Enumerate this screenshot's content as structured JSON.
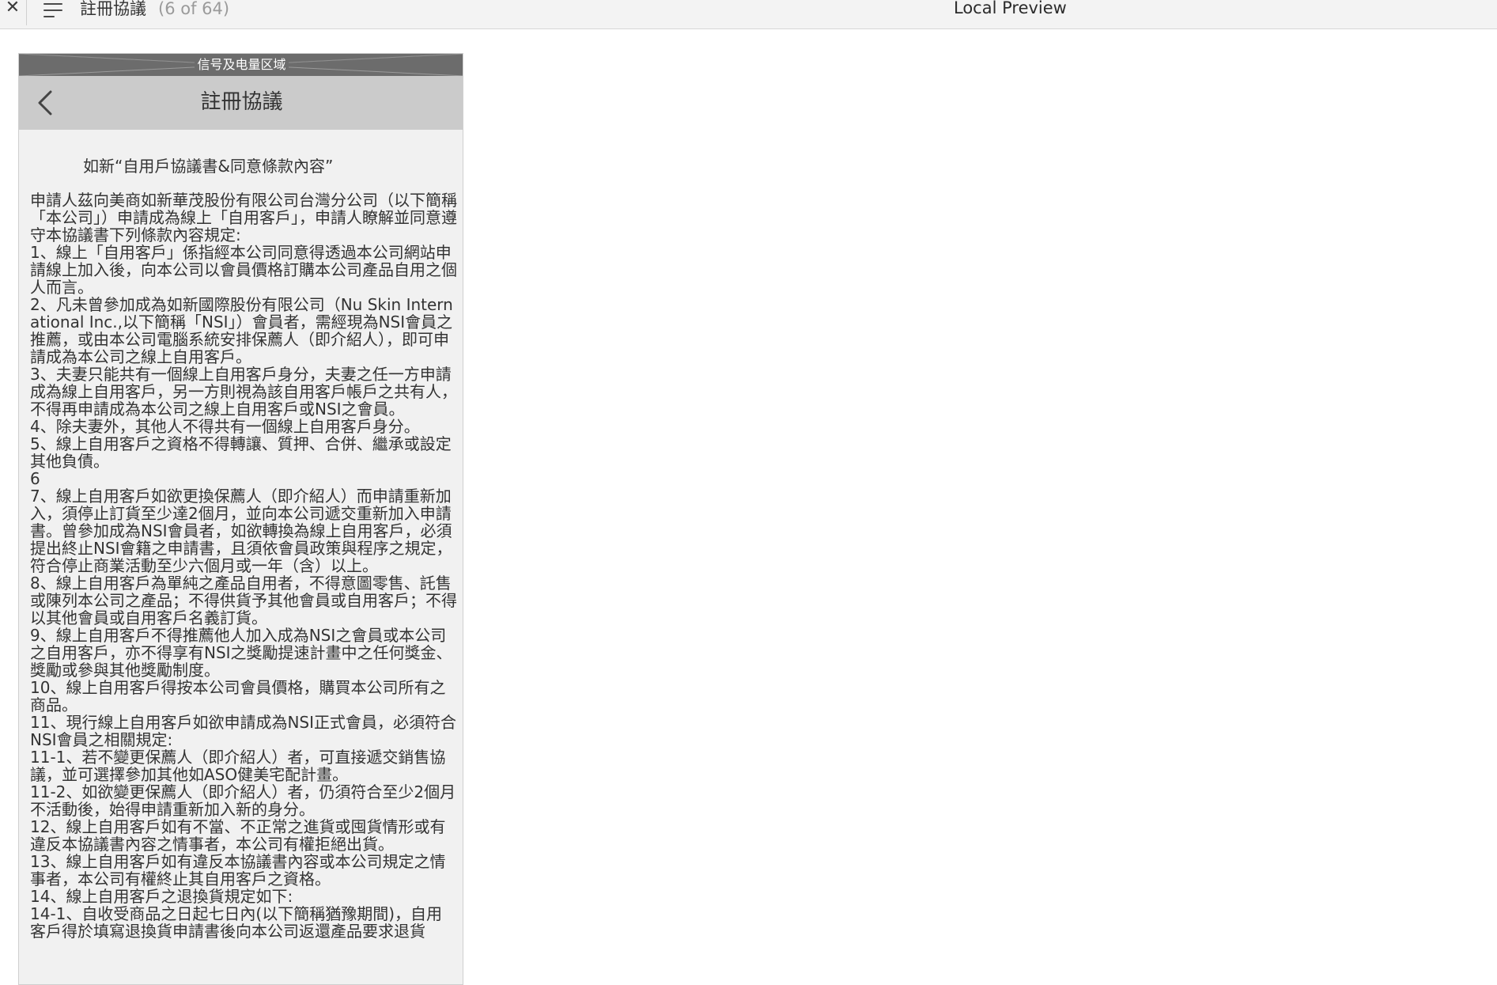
{
  "toolbar": {
    "close_glyph": "✕",
    "document_title": "註冊協議",
    "page_count": "(6 of 64)",
    "app_title": "Local Preview"
  },
  "status_bar": {
    "label": "信号及电量区域"
  },
  "navbar": {
    "title": "註冊協議"
  },
  "agreement": {
    "title": "如新“自用戶協議書&同意條款內容”",
    "paragraphs": [
      "申請人茲向美商如新華茂股份有限公司台灣分公司（以下簡稱「本公司」）申請成為線上「自用客戶」，申請人瞭解並同意遵守本協議書下列條款內容規定:",
      "1、線上「自用客戶」係指經本公司同意得透過本公司網站申請線上加入後，向本公司以會員價格訂購本公司產品自用之個人而言。",
      "2、凡未曾參加成為如新國際股份有限公司（Nu Skin International Inc.,以下簡稱「NSI」）會員者，需經現為NSI會員之推薦，或由本公司電腦系統安排保薦人（即介紹人），即可申請成為本公司之線上自用客戶。",
      "3、夫妻只能共有一個線上自用客戶身分，夫妻之任一方申請成為線上自用客戶，另一方則視為該自用客戶帳戶之共有人，不得再申請成為本公司之線上自用客戶或NSI之會員。",
      "4、除夫妻外，其他人不得共有一個線上自用客戶身分。",
      "5、線上自用客戶之資格不得轉讓、質押、合併、繼承或設定其他負債。",
      "6",
      "7、線上自用客戶如欲更換保薦人（即介紹人）而申請重新加入，須停止訂貨至少達2個月，並向本公司遞交重新加入申請書。曾參加成為NSI會員者，如欲轉換為線上自用客戶，必須提出終止NSI會籍之申請書，且須依會員政策與程序之規定，符合停止商業活動至少六個月或一年（含）以上。",
      "8、線上自用客戶為單純之產品自用者，不得意圖零售、託售或陳列本公司之產品；不得供貨予其他會員或自用客戶；不得以其他會員或自用客戶名義訂貨。",
      "9、線上自用客戶不得推薦他人加入成為NSI之會員或本公司之自用客戶，亦不得享有NSI之獎勵提速計畫中之任何獎金、獎勵或參與其他獎勵制度。",
      "10、線上自用客戶得按本公司會員價格，購買本公司所有之商品。",
      "11、現行線上自用客戶如欲申請成為NSI正式會員，必須符合NSI會員之相關規定:",
      "11-1、若不變更保薦人（即介紹人）者，可直接遞交銷售協議，並可選擇參加其他如ASO健美宅配計畫。",
      "11-2、如欲變更保薦人（即介紹人）者，仍須符合至少2個月不活動後，始得申請重新加入新的身分。",
      "12、線上自用客戶如有不當、不正常之進貨或囤貨情形或有違反本協議書內容之情事者，本公司有權拒絕出貨。",
      "13、線上自用客戶如有違反本協議書內容或本公司規定之情事者，本公司有權終止其自用客戶之資格。",
      "14、線上自用客戶之退換貨規定如下:",
      "14-1、自收受商品之日起七日內(以下簡稱猶豫期間)，自用客戶得於填寫退換貨申請書後向本公司返還產品要求退貨"
    ]
  }
}
